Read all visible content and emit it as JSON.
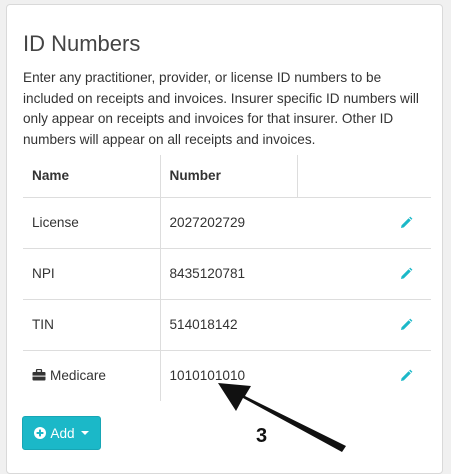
{
  "panel": {
    "title": "ID Numbers",
    "description": "Enter any practitioner, provider, or license ID numbers to be included on receipts and invoices. Insurer specific ID numbers will only appear on receipts and invoices for that insurer. Other ID numbers will appear on all receipts and invoices."
  },
  "table": {
    "headers": {
      "name": "Name",
      "number": "Number"
    },
    "rows": [
      {
        "name": "License",
        "number": "2027202729",
        "icon": ""
      },
      {
        "name": "NPI",
        "number": "8435120781",
        "icon": ""
      },
      {
        "name": "TIN",
        "number": "514018142",
        "icon": ""
      },
      {
        "name": "Medicare",
        "number": "1010101010",
        "icon": "briefcase-icon"
      }
    ]
  },
  "add_button": {
    "label": "Add"
  },
  "annotation": {
    "step_label": "3"
  },
  "colors": {
    "accent": "#1bb8c8",
    "border": "#dddddd"
  }
}
